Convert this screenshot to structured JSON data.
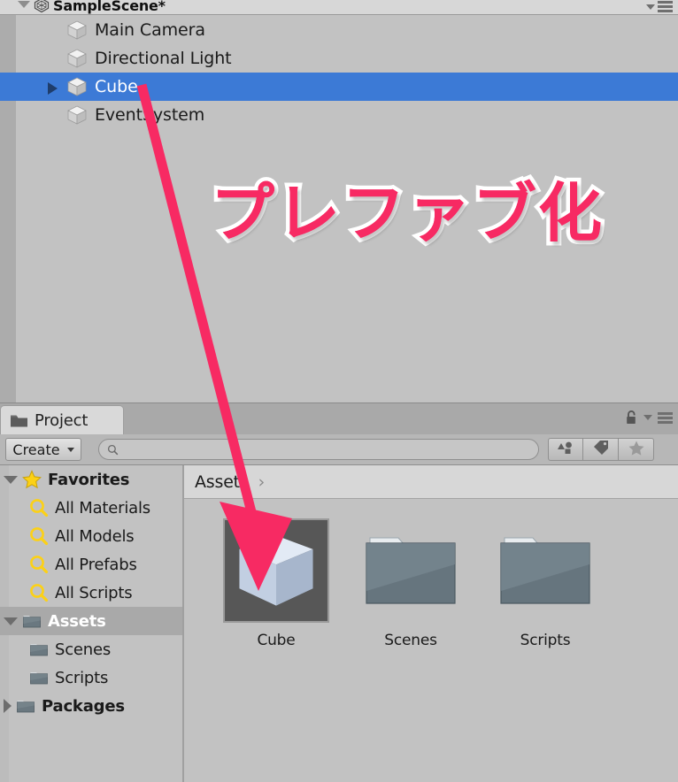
{
  "hierarchy": {
    "scene_name": "SampleScene*",
    "menu_icon": "hamburger-menu-icon",
    "dropdown_icon": "chevron-down-icon",
    "logo_icon": "unity-logo-icon",
    "rows": [
      {
        "label": "Main Camera",
        "icon": "cube-gameobject-icon",
        "selected": false,
        "expandable": false
      },
      {
        "label": "Directional Light",
        "icon": "cube-gameobject-icon",
        "selected": false,
        "expandable": false
      },
      {
        "label": "Cube",
        "icon": "cube-gameobject-icon",
        "selected": true,
        "expandable": true
      },
      {
        "label": "EventSystem",
        "icon": "cube-gameobject-icon",
        "selected": false,
        "expandable": false
      }
    ]
  },
  "project": {
    "tab_label": "Project",
    "tab_icon": "folder-icon",
    "lock_icon": "lock-open-icon",
    "menu_icon": "hamburger-menu-icon",
    "dropdown_icon": "chevron-down-icon",
    "toolbar": {
      "create_label": "Create",
      "create_dropdown_icon": "chevron-down-icon",
      "search_placeholder": "",
      "search_value": "",
      "search_icon": "magnifier-icon",
      "filters": [
        {
          "name": "filter-by-type-button",
          "icon": "shapes-icon"
        },
        {
          "name": "filter-by-label-button",
          "icon": "tag-icon"
        },
        {
          "name": "filter-by-favorite-button",
          "icon": "star-icon"
        }
      ]
    },
    "tree": [
      {
        "label": "Favorites",
        "icon": "star-icon",
        "state": "expanded",
        "depth": 0,
        "bold": true,
        "selected": false
      },
      {
        "label": "All Materials",
        "icon": "saved-search-icon",
        "state": "leaf",
        "depth": 1,
        "bold": false,
        "selected": false
      },
      {
        "label": "All Models",
        "icon": "saved-search-icon",
        "state": "leaf",
        "depth": 1,
        "bold": false,
        "selected": false
      },
      {
        "label": "All Prefabs",
        "icon": "saved-search-icon",
        "state": "leaf",
        "depth": 1,
        "bold": false,
        "selected": false
      },
      {
        "label": "All Scripts",
        "icon": "saved-search-icon",
        "state": "leaf",
        "depth": 1,
        "bold": false,
        "selected": false
      },
      {
        "label": "Assets",
        "icon": "folder-icon",
        "state": "expanded",
        "depth": 0,
        "bold": true,
        "selected": true
      },
      {
        "label": "Scenes",
        "icon": "folder-icon",
        "state": "leaf",
        "depth": 1,
        "bold": false,
        "selected": false
      },
      {
        "label": "Scripts",
        "icon": "folder-icon",
        "state": "leaf",
        "depth": 1,
        "bold": false,
        "selected": false
      },
      {
        "label": "Packages",
        "icon": "folder-icon",
        "state": "collapsed",
        "depth": 0,
        "bold": true,
        "selected": false
      }
    ],
    "breadcrumb": {
      "root": "Assets",
      "separator": "›"
    },
    "assets": [
      {
        "label": "Cube",
        "icon": "prefab-cube-thumbnail",
        "type": "prefab"
      },
      {
        "label": "Scenes",
        "icon": "folder-thumbnail",
        "type": "folder"
      },
      {
        "label": "Scripts",
        "icon": "folder-thumbnail",
        "type": "folder"
      }
    ]
  },
  "annotations": {
    "caption_text": "プレファブ化",
    "caption_color": "#f72a63",
    "caption_outline_color": "#ffffff",
    "arrow_color": "#f72a63",
    "arrow_name": "drag-to-prefab-arrow"
  },
  "colors": {
    "selection_blue": "#3c7ad6",
    "panel_bg": "#c2c2c2",
    "toolbar_bg": "#b7b7b7",
    "tab_bg": "#d9d9d9",
    "accent_pink": "#f72a63"
  }
}
